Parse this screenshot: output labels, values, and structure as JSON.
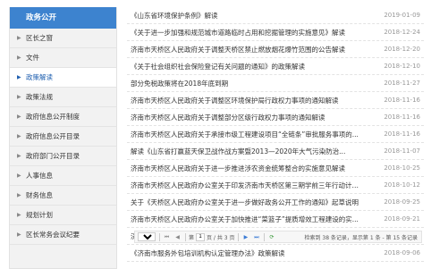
{
  "sidebar": {
    "header": "政务公开",
    "items": [
      {
        "label": "区长之窗",
        "active": false
      },
      {
        "label": "文件",
        "active": false
      },
      {
        "label": "政策解读",
        "active": true
      },
      {
        "label": "政策法规",
        "active": false
      },
      {
        "label": "政府信息公开制度",
        "active": false
      },
      {
        "label": "政府信息公开目录",
        "active": false
      },
      {
        "label": "政府部门公开目录",
        "active": false
      },
      {
        "label": "人事信息",
        "active": false
      },
      {
        "label": "财务信息",
        "active": false
      },
      {
        "label": "规划计划",
        "active": false
      },
      {
        "label": "区长常务会议纪要",
        "active": false
      }
    ]
  },
  "news": [
    {
      "title": "《山东省环境保护条例》解读",
      "date": "2019-01-09"
    },
    {
      "title": "《关于进一步加强和规范城市道路临时占用和挖掘管理的实施意见》解读",
      "date": "2018-12-24"
    },
    {
      "title": "济南市天桥区人民政府关于调整天桥区禁止燃放烟花爆竹范围的公告解读",
      "date": "2018-12-20"
    },
    {
      "title": "《关于社会组织社会保险登记有关问题的通知》的政策解读",
      "date": "2018-12-10"
    },
    {
      "title": "部分免税政策将在2018年底到期",
      "date": "2018-11-27"
    },
    {
      "title": "济南市天桥区人民政府关于调整区环境保护局行政权力事项的通知解读",
      "date": "2018-11-16"
    },
    {
      "title": "济南市天桥区人民政府关于调整部分区级行政权力事项的通知解读",
      "date": "2018-11-16"
    },
    {
      "title": "济南市天桥区人民政府关于承接市级工程建设项目“全链条”审批服务事项的...",
      "date": "2018-11-16"
    },
    {
      "title": "解读《山东省打赢蓝天保卫战作战方案暨2013—2020年大气污染防治...",
      "date": "2018-11-07"
    },
    {
      "title": "济南市天桥区人民政府关于进一步推进涉农资金统筹整合的实施意见解读",
      "date": "2018-10-25"
    },
    {
      "title": "济南市天桥区人民政府办公室关于印发济南市天桥区第三期学前三年行动计划...",
      "date": "2018-10-12"
    },
    {
      "title": "关于《天桥区人民政府办公室关于进一步做好政务公开工作的通知》起草说明",
      "date": "2018-09-25"
    },
    {
      "title": "济南市天桥区人民政府办公室关于加快推进“菜篮子”提质增效工程建设的实...",
      "date": "2018-09-21"
    },
    {
      "title": "济南市天桥区人民政府关于做好济南市天桥区人民政府残疾人工作委员会...",
      "date": "2018-09-17"
    },
    {
      "title": "《济南市服务外包培训机构认定管理办法》政策解读",
      "date": "2018-09-06"
    }
  ],
  "pager": {
    "page_size": "15",
    "page_label": "第",
    "current_page": "1",
    "total_pages": "页 / 共 3 页",
    "info": "检索到 38 条记录，显示第 1 条 - 第 15 条记录"
  }
}
